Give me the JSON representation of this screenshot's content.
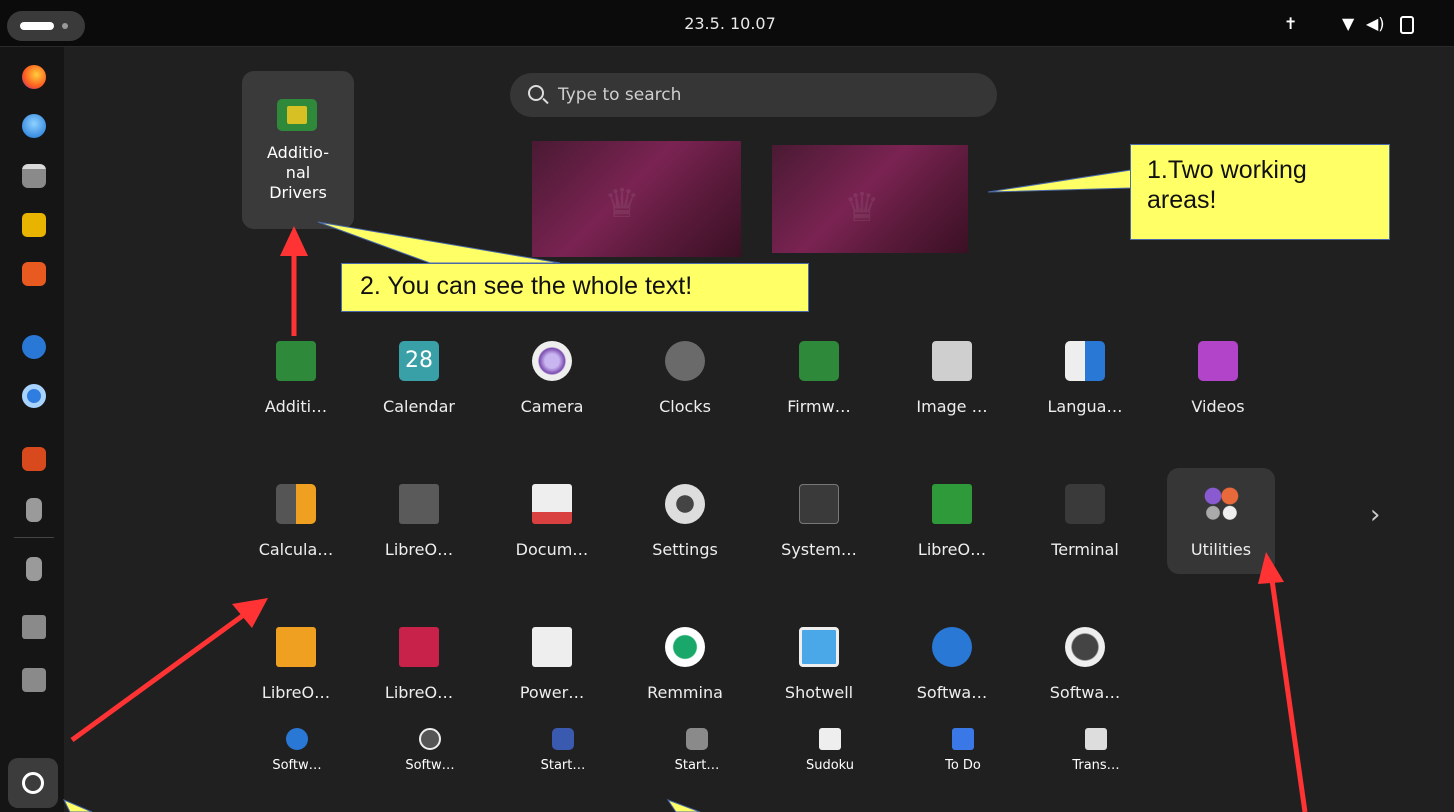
{
  "topbar": {
    "activities_label": "Activities",
    "clock": "23.5.  10.07",
    "tray_icons": [
      "accessibility-icon",
      "wifi-icon",
      "volume-icon",
      "battery-icon"
    ]
  },
  "dock": {
    "items": [
      "firefox",
      "thunderbird",
      "files",
      "rhythmbox",
      "app-center",
      "help",
      "chromium",
      "libreoffice-impress",
      "usb-drive",
      "usb-drive",
      "ssd-drive",
      "trash"
    ],
    "show_apps_label": "Show Apps"
  },
  "search": {
    "placeholder": "Type to search"
  },
  "workspaces": [
    "Workspace 1",
    "Workspace 2"
  ],
  "folder_popup": {
    "label": "Additio-\nnal\nDrivers"
  },
  "apps": {
    "row1": [
      {
        "label": "Additi…"
      },
      {
        "label": "Calendar",
        "badge": "28"
      },
      {
        "label": "Camera"
      },
      {
        "label": "Clocks"
      },
      {
        "label": "Firmw…"
      },
      {
        "label": "Image …"
      },
      {
        "label": "Langua…"
      },
      {
        "label": "Videos"
      }
    ],
    "row2": [
      {
        "label": "Calcula…"
      },
      {
        "label": "LibreO…"
      },
      {
        "label": "Docum…"
      },
      {
        "label": "Settings"
      },
      {
        "label": "System…"
      },
      {
        "label": "LibreO…"
      },
      {
        "label": "Terminal"
      },
      {
        "label": "Utilities"
      }
    ],
    "row3": [
      {
        "label": "LibreO…"
      },
      {
        "label": "LibreO…"
      },
      {
        "label": "Power…"
      },
      {
        "label": "Remmina"
      },
      {
        "label": "Shotwell"
      },
      {
        "label": "Softwa…"
      },
      {
        "label": "Softwa…"
      }
    ],
    "row4": [
      {
        "label": "Softw…"
      },
      {
        "label": "Softw…"
      },
      {
        "label": "Start…"
      },
      {
        "label": "Start…"
      },
      {
        "label": "Sudoku"
      },
      {
        "label": "To Do"
      },
      {
        "label": "Trans…"
      }
    ]
  },
  "annotations": {
    "callout1": "1.Two working\n areas!",
    "callout2": "2. You can see the whole text!"
  },
  "colors": {
    "accent": "#ffff66",
    "arrow": "#ff3333",
    "background": "#202020"
  }
}
